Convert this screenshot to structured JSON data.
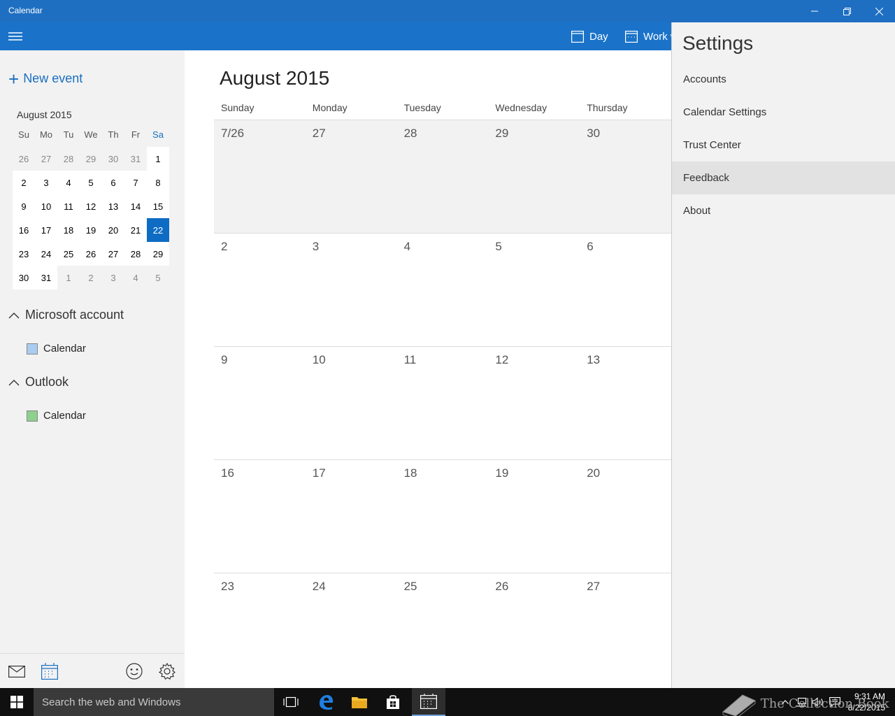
{
  "window": {
    "title": "Calendar"
  },
  "toolbar": {
    "day_label": "Day",
    "workweek_label": "Work w"
  },
  "sidebar": {
    "new_event_label": "New event",
    "mini_calendar": {
      "title": "August 2015",
      "weekday_headers": [
        "Su",
        "Mo",
        "Tu",
        "We",
        "Th",
        "Fr",
        "Sa"
      ],
      "weeks": [
        [
          "26",
          "27",
          "28",
          "29",
          "30",
          "31",
          "1"
        ],
        [
          "2",
          "3",
          "4",
          "5",
          "6",
          "7",
          "8"
        ],
        [
          "9",
          "10",
          "11",
          "12",
          "13",
          "14",
          "15"
        ],
        [
          "16",
          "17",
          "18",
          "19",
          "20",
          "21",
          "22"
        ],
        [
          "23",
          "24",
          "25",
          "26",
          "27",
          "28",
          "29"
        ],
        [
          "30",
          "31",
          "1",
          "2",
          "3",
          "4",
          "5"
        ]
      ],
      "today": "22"
    },
    "accounts": [
      {
        "name": "Microsoft account",
        "calendar": "Calendar",
        "color": "#a9cdf0"
      },
      {
        "name": "Outlook",
        "calendar": "Calendar",
        "color": "#8ed08e"
      }
    ]
  },
  "main": {
    "month_title": "August 2015",
    "day_headers": [
      "Sunday",
      "Monday",
      "Tuesday",
      "Wednesday",
      "Thursday"
    ],
    "weeks": [
      [
        "7/26",
        "27",
        "28",
        "29",
        "30"
      ],
      [
        "2",
        "3",
        "4",
        "5",
        "6"
      ],
      [
        "9",
        "10",
        "11",
        "12",
        "13"
      ],
      [
        "16",
        "17",
        "18",
        "19",
        "20"
      ],
      [
        "23",
        "24",
        "25",
        "26",
        "27"
      ]
    ]
  },
  "settings": {
    "title": "Settings",
    "items": [
      "Accounts",
      "Calendar Settings",
      "Trust Center",
      "Feedback",
      "About"
    ]
  },
  "taskbar": {
    "search_placeholder": "Search the web and Windows",
    "time": "9:31 AM",
    "date": "8/22/2015"
  },
  "watermark": "The Collection Book",
  "colors": {
    "accent": "#1a73c9",
    "titlebar": "#1e6fc2",
    "today": "#0f6cc4"
  }
}
